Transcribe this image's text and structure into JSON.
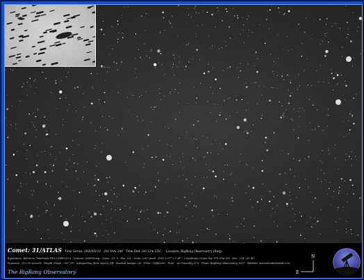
{
  "caption": {
    "comet_title": "Comet: 31/ATLAS",
    "line1_rest": "· Time Series: 2020/02/12 · 201 thru 240 · Time End: 3/9 12m UTC · · Location: BigBang Observatory (Italy)",
    "line2": "Equipment: Refractor Takahashi FSQ-106ED f/3.6 · Camera: QSI583wsg · Temp: -10° C · Bin: 1x1 · Scale: 3.82\"/pixel · FOV: 1.07° x 1.41° · Coordinate Center RA: 6°h 23m 55s · Dec: +38° 28' 40\"",
    "line3": "Exposure: 25 x 60 seconds · Height Origin: +65° 59' · Autoguiding (blue object) Off · Stacked Images: On · Filter: Unfiltered · Note: · Air humidity 87% · Photo: BigBang Observatory 2017 · WebSite: www.ideadiprobadi.com",
    "brand": "The BigBang Observatory"
  },
  "compass": {
    "north": "N",
    "east": "E"
  },
  "colors": {
    "frame": "#1f4fbf",
    "field": "#2e2e2e",
    "brand_text": "#b9ccff"
  }
}
